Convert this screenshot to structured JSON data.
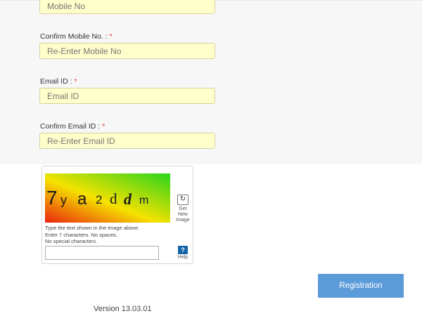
{
  "form": {
    "mobile_placeholder": "Mobile No",
    "confirm_mobile_label": "Confirm Mobile No. : ",
    "confirm_mobile_placeholder": "Re-Enter Mobile No",
    "email_label": "Email ID : ",
    "email_placeholder": "Email ID",
    "confirm_email_label": "Confirm Email ID : ",
    "confirm_email_placeholder": "Re-Enter Email ID",
    "required_marker": "*"
  },
  "captcha": {
    "text_chars": [
      "7",
      "y",
      "a",
      "2",
      "d",
      "d",
      "m"
    ],
    "refresh_icon": "refresh-icon",
    "refresh_label_1": "Get",
    "refresh_label_2": "New",
    "refresh_label_3": "Image",
    "help_icon_glyph": "?",
    "help_label": "Help",
    "instruction_1": "Type the text shown in the image above.",
    "instruction_2": "Enter 7 characters. No spaces.",
    "instruction_3": "No special characters."
  },
  "actions": {
    "register_label": "Registration"
  },
  "footer": {
    "version": "Version 13.03.01"
  },
  "colors": {
    "input_bg": "#ffffcc",
    "button": "#5b9bd9",
    "required": "#e53935"
  }
}
